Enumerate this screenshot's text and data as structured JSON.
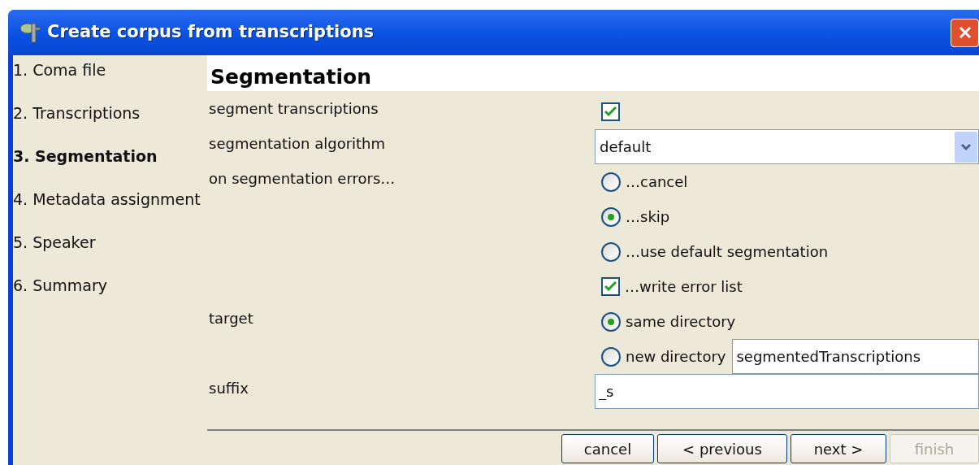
{
  "window": {
    "title": "Create corpus from transcriptions"
  },
  "sidebar": {
    "items": [
      {
        "label": "1. Coma file",
        "selected": false
      },
      {
        "label": "2. Transcriptions",
        "selected": false
      },
      {
        "label": "3. Segmentation",
        "selected": true
      },
      {
        "label": "4. Metadata assignment",
        "selected": false
      },
      {
        "label": "5. Speaker",
        "selected": false
      },
      {
        "label": "6. Summary",
        "selected": false
      }
    ]
  },
  "panel": {
    "heading": "Segmentation",
    "rows": [
      {
        "label": "segment transcriptions",
        "control": {
          "kind": "checkbox",
          "checked": true
        }
      },
      {
        "label": "segmentation algorithm",
        "control": {
          "kind": "select",
          "value": "default"
        }
      },
      {
        "label": "on segmentation errors…",
        "control": {
          "kind": "radio",
          "text": "…cancel",
          "selected": false
        }
      },
      {
        "control": {
          "kind": "radio",
          "text": "…skip",
          "selected": true
        }
      },
      {
        "control": {
          "kind": "radio",
          "text": "…use default segmentation",
          "selected": false
        }
      },
      {
        "control": {
          "kind": "checkbox",
          "text": "…write error list",
          "checked": true
        }
      },
      {
        "label": "target",
        "control": {
          "kind": "radio",
          "text": "same directory",
          "selected": true
        }
      },
      {
        "control": {
          "kind": "radio",
          "text": "new directory",
          "selected": false,
          "field_value": "segmentedTranscriptions"
        }
      },
      {
        "label": "suffix",
        "control": {
          "kind": "text",
          "value": "_s"
        }
      }
    ]
  },
  "buttons": [
    {
      "label": "cancel",
      "disabled": false
    },
    {
      "label": "< previous",
      "disabled": false
    },
    {
      "label": "next >",
      "disabled": false
    },
    {
      "label": "finish",
      "disabled": true
    }
  ]
}
